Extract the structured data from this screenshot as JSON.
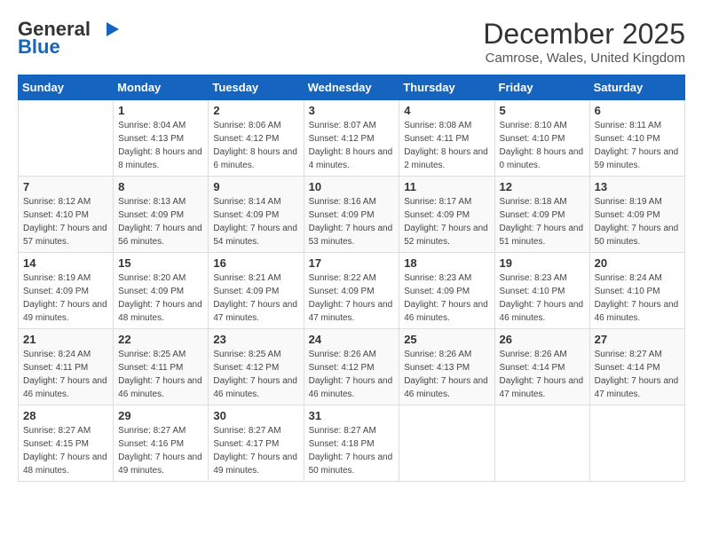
{
  "header": {
    "logo_general": "General",
    "logo_blue": "Blue",
    "month_title": "December 2025",
    "subtitle": "Camrose, Wales, United Kingdom"
  },
  "weekdays": [
    "Sunday",
    "Monday",
    "Tuesday",
    "Wednesday",
    "Thursday",
    "Friday",
    "Saturday"
  ],
  "weeks": [
    [
      {
        "day": "",
        "sunrise": "",
        "sunset": "",
        "daylight": ""
      },
      {
        "day": "1",
        "sunrise": "Sunrise: 8:04 AM",
        "sunset": "Sunset: 4:13 PM",
        "daylight": "Daylight: 8 hours and 8 minutes."
      },
      {
        "day": "2",
        "sunrise": "Sunrise: 8:06 AM",
        "sunset": "Sunset: 4:12 PM",
        "daylight": "Daylight: 8 hours and 6 minutes."
      },
      {
        "day": "3",
        "sunrise": "Sunrise: 8:07 AM",
        "sunset": "Sunset: 4:12 PM",
        "daylight": "Daylight: 8 hours and 4 minutes."
      },
      {
        "day": "4",
        "sunrise": "Sunrise: 8:08 AM",
        "sunset": "Sunset: 4:11 PM",
        "daylight": "Daylight: 8 hours and 2 minutes."
      },
      {
        "day": "5",
        "sunrise": "Sunrise: 8:10 AM",
        "sunset": "Sunset: 4:10 PM",
        "daylight": "Daylight: 8 hours and 0 minutes."
      },
      {
        "day": "6",
        "sunrise": "Sunrise: 8:11 AM",
        "sunset": "Sunset: 4:10 PM",
        "daylight": "Daylight: 7 hours and 59 minutes."
      }
    ],
    [
      {
        "day": "7",
        "sunrise": "Sunrise: 8:12 AM",
        "sunset": "Sunset: 4:10 PM",
        "daylight": "Daylight: 7 hours and 57 minutes."
      },
      {
        "day": "8",
        "sunrise": "Sunrise: 8:13 AM",
        "sunset": "Sunset: 4:09 PM",
        "daylight": "Daylight: 7 hours and 56 minutes."
      },
      {
        "day": "9",
        "sunrise": "Sunrise: 8:14 AM",
        "sunset": "Sunset: 4:09 PM",
        "daylight": "Daylight: 7 hours and 54 minutes."
      },
      {
        "day": "10",
        "sunrise": "Sunrise: 8:16 AM",
        "sunset": "Sunset: 4:09 PM",
        "daylight": "Daylight: 7 hours and 53 minutes."
      },
      {
        "day": "11",
        "sunrise": "Sunrise: 8:17 AM",
        "sunset": "Sunset: 4:09 PM",
        "daylight": "Daylight: 7 hours and 52 minutes."
      },
      {
        "day": "12",
        "sunrise": "Sunrise: 8:18 AM",
        "sunset": "Sunset: 4:09 PM",
        "daylight": "Daylight: 7 hours and 51 minutes."
      },
      {
        "day": "13",
        "sunrise": "Sunrise: 8:19 AM",
        "sunset": "Sunset: 4:09 PM",
        "daylight": "Daylight: 7 hours and 50 minutes."
      }
    ],
    [
      {
        "day": "14",
        "sunrise": "Sunrise: 8:19 AM",
        "sunset": "Sunset: 4:09 PM",
        "daylight": "Daylight: 7 hours and 49 minutes."
      },
      {
        "day": "15",
        "sunrise": "Sunrise: 8:20 AM",
        "sunset": "Sunset: 4:09 PM",
        "daylight": "Daylight: 7 hours and 48 minutes."
      },
      {
        "day": "16",
        "sunrise": "Sunrise: 8:21 AM",
        "sunset": "Sunset: 4:09 PM",
        "daylight": "Daylight: 7 hours and 47 minutes."
      },
      {
        "day": "17",
        "sunrise": "Sunrise: 8:22 AM",
        "sunset": "Sunset: 4:09 PM",
        "daylight": "Daylight: 7 hours and 47 minutes."
      },
      {
        "day": "18",
        "sunrise": "Sunrise: 8:23 AM",
        "sunset": "Sunset: 4:09 PM",
        "daylight": "Daylight: 7 hours and 46 minutes."
      },
      {
        "day": "19",
        "sunrise": "Sunrise: 8:23 AM",
        "sunset": "Sunset: 4:10 PM",
        "daylight": "Daylight: 7 hours and 46 minutes."
      },
      {
        "day": "20",
        "sunrise": "Sunrise: 8:24 AM",
        "sunset": "Sunset: 4:10 PM",
        "daylight": "Daylight: 7 hours and 46 minutes."
      }
    ],
    [
      {
        "day": "21",
        "sunrise": "Sunrise: 8:24 AM",
        "sunset": "Sunset: 4:11 PM",
        "daylight": "Daylight: 7 hours and 46 minutes."
      },
      {
        "day": "22",
        "sunrise": "Sunrise: 8:25 AM",
        "sunset": "Sunset: 4:11 PM",
        "daylight": "Daylight: 7 hours and 46 minutes."
      },
      {
        "day": "23",
        "sunrise": "Sunrise: 8:25 AM",
        "sunset": "Sunset: 4:12 PM",
        "daylight": "Daylight: 7 hours and 46 minutes."
      },
      {
        "day": "24",
        "sunrise": "Sunrise: 8:26 AM",
        "sunset": "Sunset: 4:12 PM",
        "daylight": "Daylight: 7 hours and 46 minutes."
      },
      {
        "day": "25",
        "sunrise": "Sunrise: 8:26 AM",
        "sunset": "Sunset: 4:13 PM",
        "daylight": "Daylight: 7 hours and 46 minutes."
      },
      {
        "day": "26",
        "sunrise": "Sunrise: 8:26 AM",
        "sunset": "Sunset: 4:14 PM",
        "daylight": "Daylight: 7 hours and 47 minutes."
      },
      {
        "day": "27",
        "sunrise": "Sunrise: 8:27 AM",
        "sunset": "Sunset: 4:14 PM",
        "daylight": "Daylight: 7 hours and 47 minutes."
      }
    ],
    [
      {
        "day": "28",
        "sunrise": "Sunrise: 8:27 AM",
        "sunset": "Sunset: 4:15 PM",
        "daylight": "Daylight: 7 hours and 48 minutes."
      },
      {
        "day": "29",
        "sunrise": "Sunrise: 8:27 AM",
        "sunset": "Sunset: 4:16 PM",
        "daylight": "Daylight: 7 hours and 49 minutes."
      },
      {
        "day": "30",
        "sunrise": "Sunrise: 8:27 AM",
        "sunset": "Sunset: 4:17 PM",
        "daylight": "Daylight: 7 hours and 49 minutes."
      },
      {
        "day": "31",
        "sunrise": "Sunrise: 8:27 AM",
        "sunset": "Sunset: 4:18 PM",
        "daylight": "Daylight: 7 hours and 50 minutes."
      },
      {
        "day": "",
        "sunrise": "",
        "sunset": "",
        "daylight": ""
      },
      {
        "day": "",
        "sunrise": "",
        "sunset": "",
        "daylight": ""
      },
      {
        "day": "",
        "sunrise": "",
        "sunset": "",
        "daylight": ""
      }
    ]
  ]
}
